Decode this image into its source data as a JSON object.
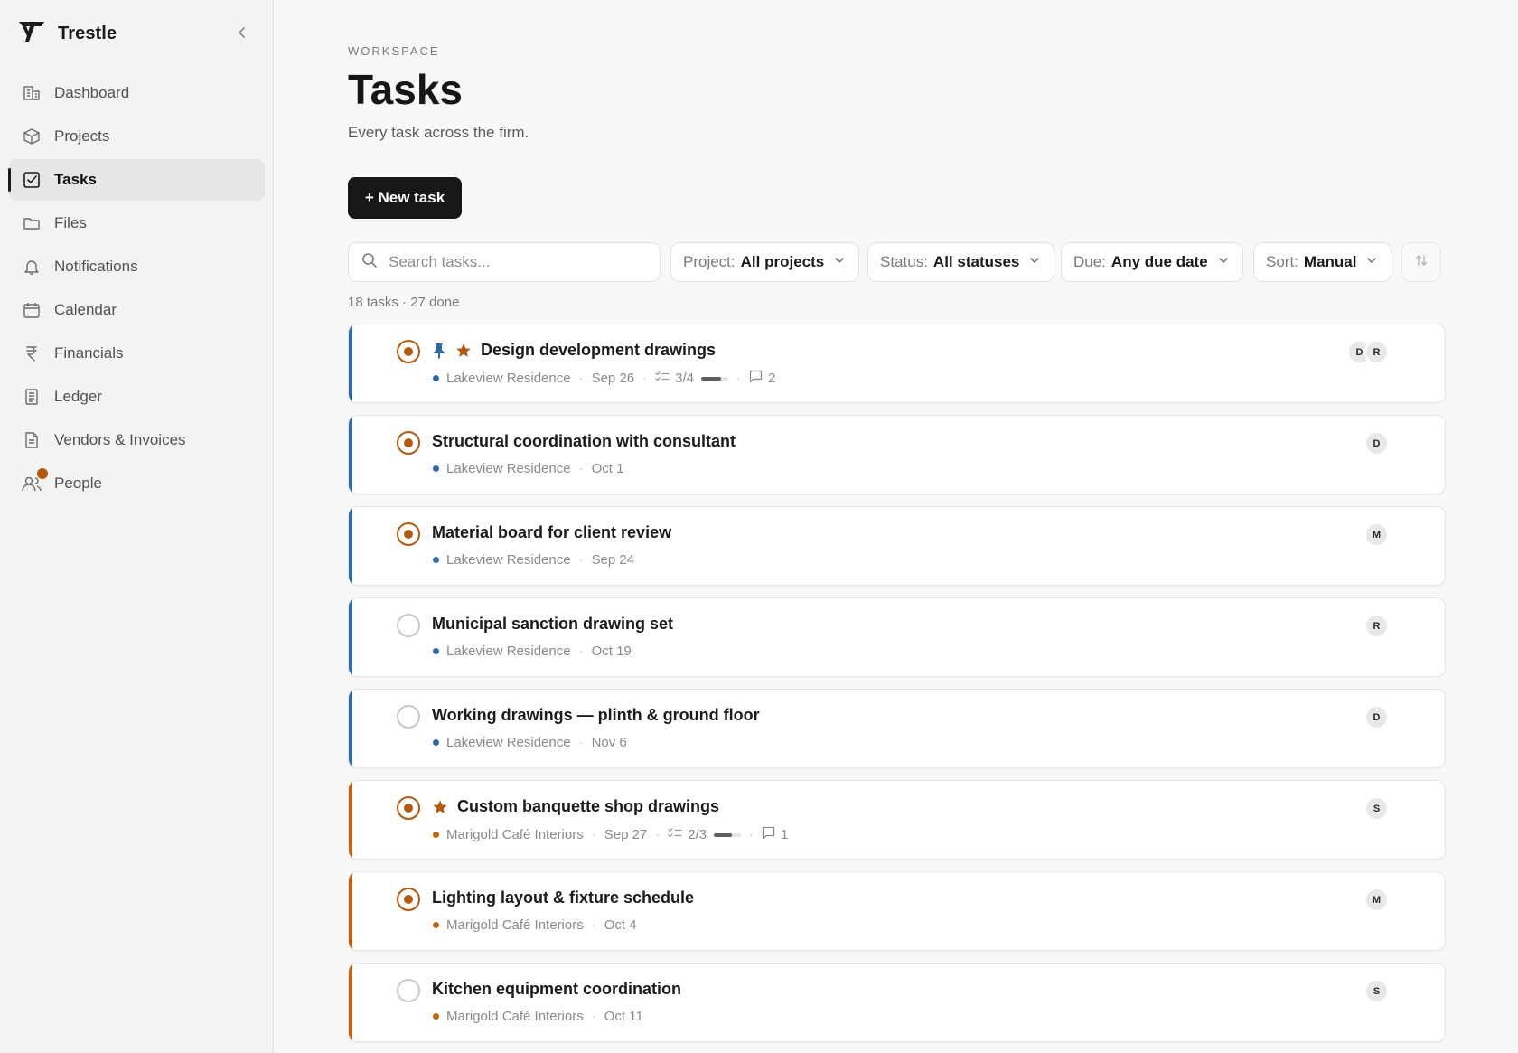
{
  "app": {
    "name": "Trestle"
  },
  "sidebar": {
    "items": [
      {
        "label": "Dashboard",
        "icon": "dashboard-icon"
      },
      {
        "label": "Projects",
        "icon": "box-icon"
      },
      {
        "label": "Tasks",
        "icon": "checkbox-icon",
        "active": true
      },
      {
        "label": "Files",
        "icon": "folder-icon"
      },
      {
        "label": "Notifications",
        "icon": "bell-icon"
      },
      {
        "label": "Calendar",
        "icon": "calendar-icon"
      },
      {
        "label": "Financials",
        "icon": "rupee-icon"
      },
      {
        "label": "Ledger",
        "icon": "ledger-icon"
      },
      {
        "label": "Vendors & Invoices",
        "icon": "invoice-icon"
      },
      {
        "label": "People",
        "icon": "people-icon",
        "badge": true
      }
    ]
  },
  "header": {
    "eyebrow": "WORKSPACE",
    "title": "Tasks",
    "subtitle": "Every task across the firm.",
    "new_task_label": "+ New task"
  },
  "filters": {
    "search_placeholder": "Search tasks...",
    "project": {
      "label": "Project:",
      "value": "All projects"
    },
    "status": {
      "label": "Status:",
      "value": "All statuses"
    },
    "due": {
      "label": "Due:",
      "value": "Any due date"
    },
    "sort": {
      "label": "Sort:",
      "value": "Manual"
    }
  },
  "summary": "18 tasks · 27 done",
  "colors": {
    "accent": "#b35a0e",
    "lakeview": "#2f6aa8",
    "marigold": "#c0620e"
  },
  "tasks": [
    {
      "title": "Design development drawings",
      "pinned": true,
      "starred": true,
      "status": "in-progress",
      "project": "Lakeview Residence",
      "project_color": "#2f6aa8",
      "due": "Sep 26",
      "subtasks": "3/4",
      "progress": 0.75,
      "comments": "2",
      "assignees": [
        "D",
        "R"
      ]
    },
    {
      "title": "Structural coordination with consultant",
      "status": "in-progress",
      "project": "Lakeview Residence",
      "project_color": "#2f6aa8",
      "due": "Oct 1",
      "assignees": [
        "D"
      ]
    },
    {
      "title": "Material board for client review",
      "status": "in-progress",
      "project": "Lakeview Residence",
      "project_color": "#2f6aa8",
      "due": "Sep 24",
      "assignees": [
        "M"
      ]
    },
    {
      "title": "Municipal sanction drawing set",
      "status": "todo",
      "project": "Lakeview Residence",
      "project_color": "#2f6aa8",
      "due": "Oct 19",
      "assignees": [
        "R"
      ]
    },
    {
      "title": "Working drawings — plinth & ground floor",
      "status": "todo",
      "project": "Lakeview Residence",
      "project_color": "#2f6aa8",
      "due": "Nov 6",
      "assignees": [
        "D"
      ]
    },
    {
      "title": "Custom banquette shop drawings",
      "starred": true,
      "status": "in-progress",
      "project": "Marigold Café Interiors",
      "project_color": "#c0620e",
      "due": "Sep 27",
      "subtasks": "2/3",
      "progress": 0.67,
      "comments": "1",
      "assignees": [
        "S"
      ]
    },
    {
      "title": "Lighting layout & fixture schedule",
      "status": "in-progress",
      "project": "Marigold Café Interiors",
      "project_color": "#c0620e",
      "due": "Oct 4",
      "assignees": [
        "M"
      ]
    },
    {
      "title": "Kitchen equipment coordination",
      "status": "todo",
      "project": "Marigold Café Interiors",
      "project_color": "#c0620e",
      "due": "Oct 11",
      "assignees": [
        "S"
      ]
    }
  ]
}
